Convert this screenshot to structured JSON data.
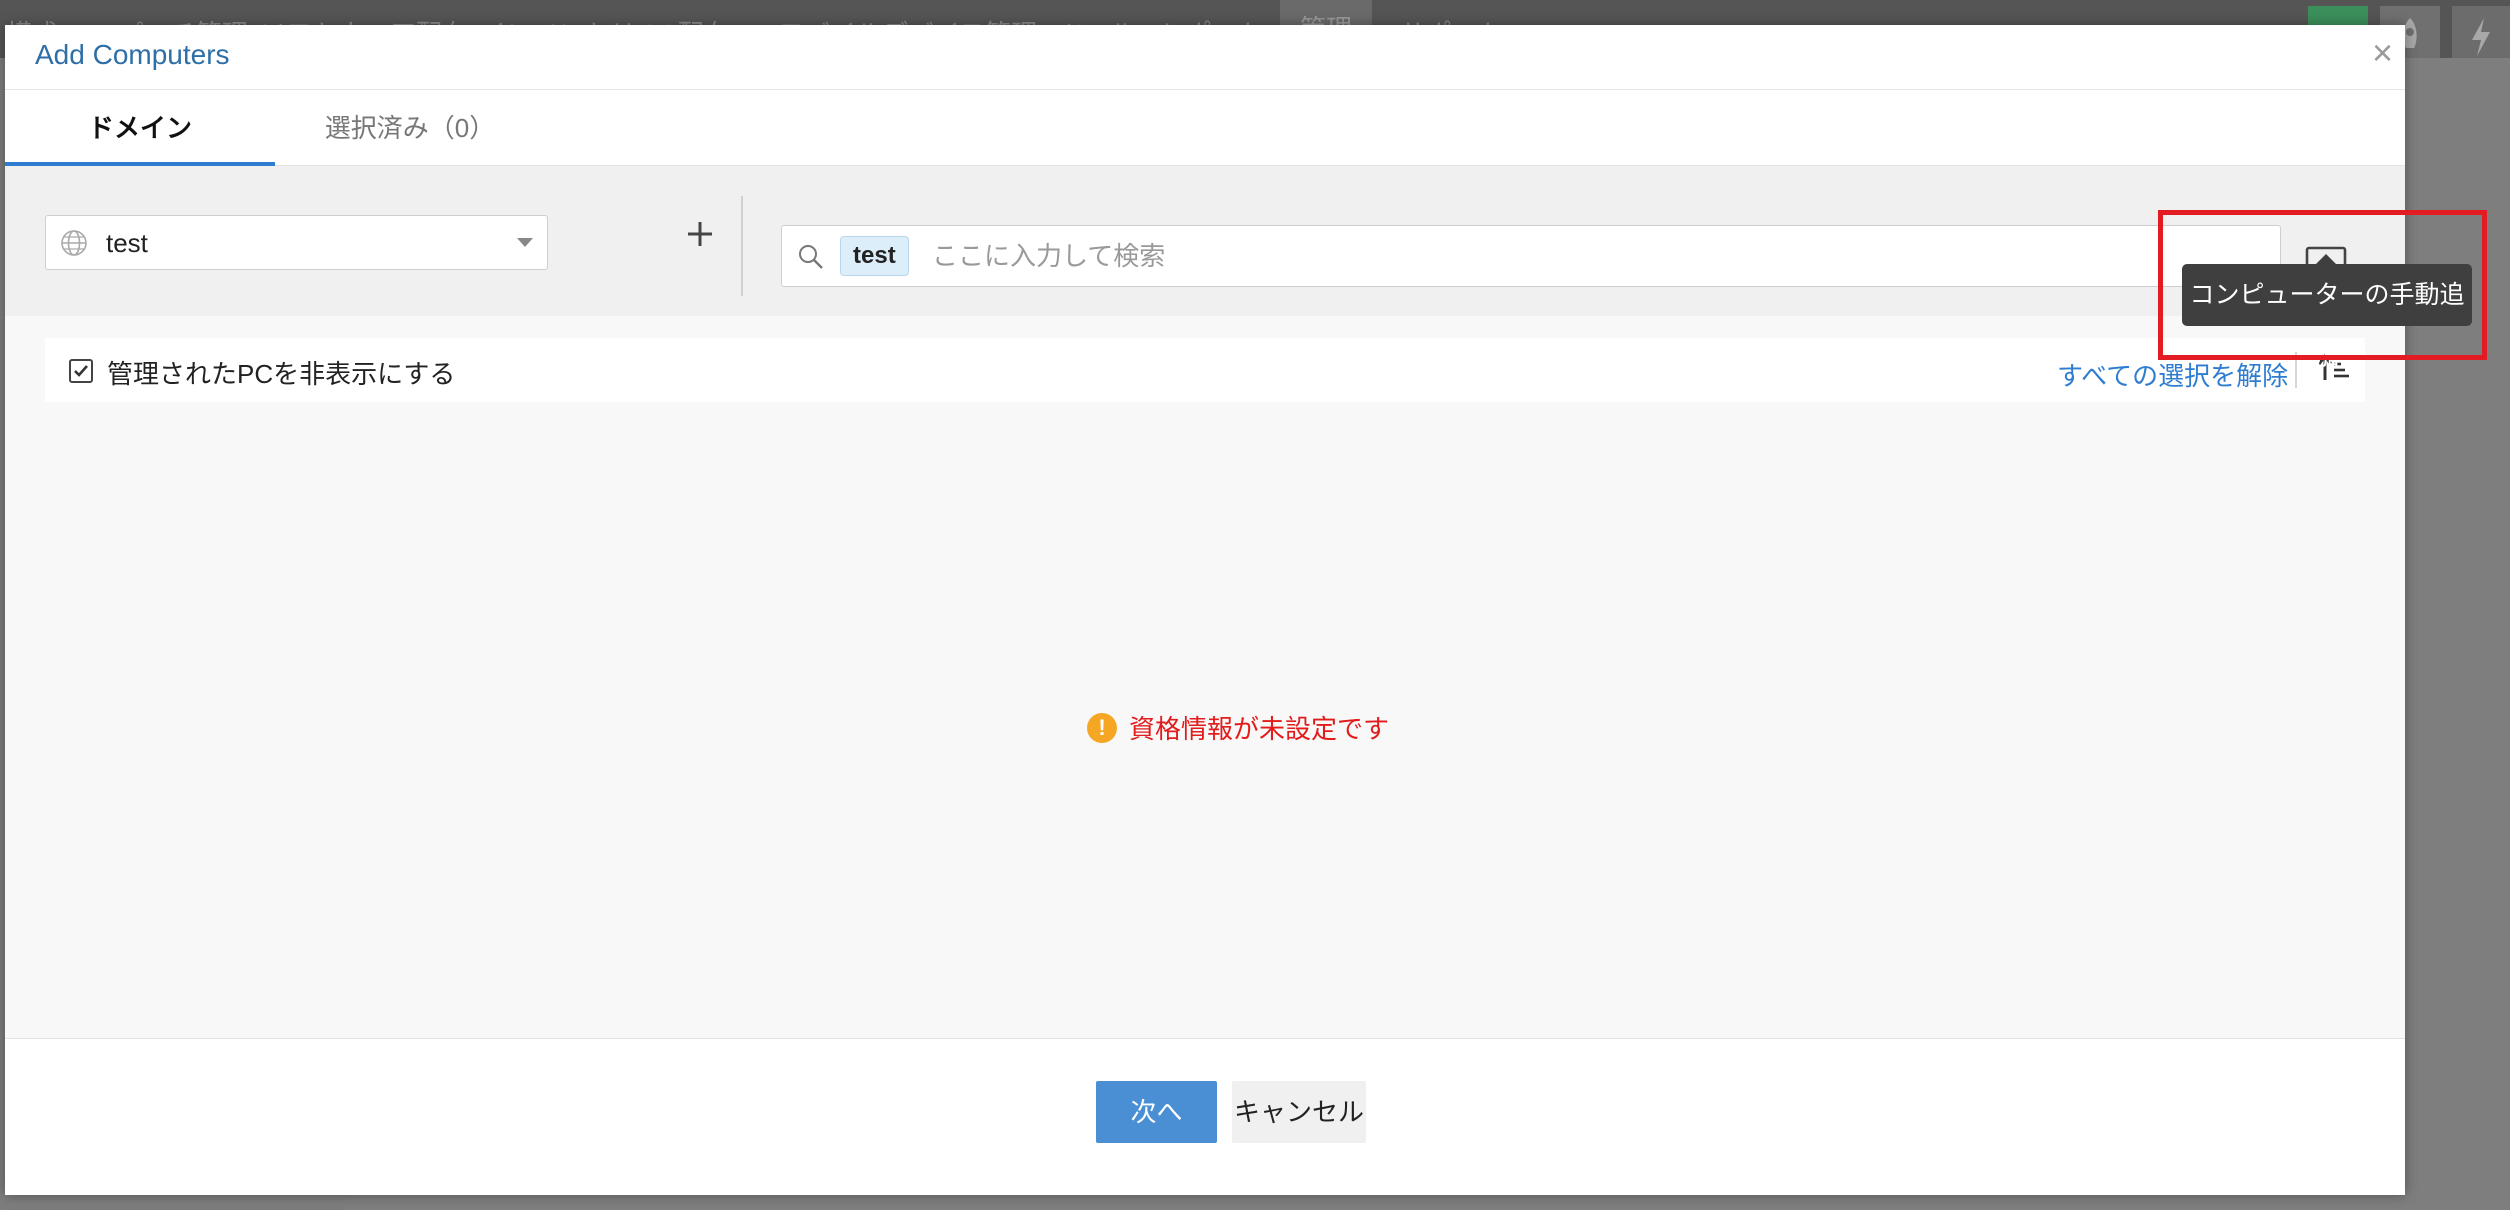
{
  "background": {
    "nav_items": [
      "構成",
      "パッチ管理",
      "ソフトウェア配布",
      "インベントリー",
      "OS配布",
      "モバイルデバイス管理",
      "ツール",
      "レポート",
      "管理",
      "サポート"
    ]
  },
  "modal": {
    "title": "Add Computers",
    "close_label": "×",
    "tabs": [
      {
        "label": "ドメイン",
        "active": true
      },
      {
        "label": "選択済み（0）",
        "active": false
      }
    ],
    "domain_select": {
      "value": "test"
    },
    "search": {
      "chip": "test",
      "placeholder": "ここに入力して検索"
    },
    "add_computer_tooltip": "コンピューターの手動追加",
    "filter": {
      "hide_managed_label": "管理されたPCを非表示にする",
      "hide_managed_checked": true,
      "deselect_all_label": "すべての選択を解除"
    },
    "empty_message": "資格情報が未設定です",
    "footer": {
      "next_label": "次へ",
      "cancel_label": "キャンセル"
    }
  },
  "colors": {
    "accent": "#2e7dd1",
    "primary_button": "#4a8fd4",
    "error_text": "#e21b1b",
    "warning_icon": "#f5a623",
    "highlight": "#e31c24"
  }
}
